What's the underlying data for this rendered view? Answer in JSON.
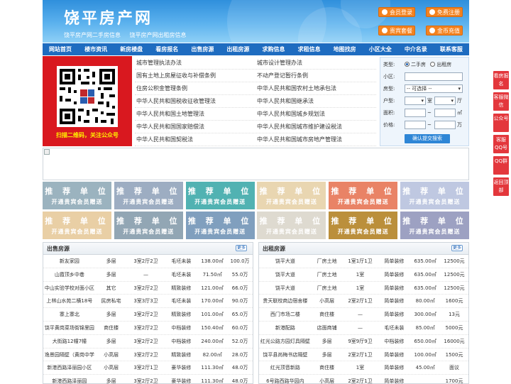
{
  "header": {
    "title": "饶平房产网",
    "subtitles": [
      "饶平房产网二手房信息",
      "饶平房产网出租房信息"
    ],
    "buttons": [
      "会员登录",
      "免费注册",
      "贵宾套餐",
      "金币充值"
    ]
  },
  "nav": [
    "网站首页",
    "楼市资讯",
    "新房楼盘",
    "看房报名",
    "出售房源",
    "出租房源",
    "求购信息",
    "求租信息",
    "地图找房",
    "小区大全",
    "中介名录",
    "联系客服"
  ],
  "qr": {
    "caption": "扫描二维码，关注公众号"
  },
  "links": [
    [
      "城市管理执法办法",
      "城市设计管理办法"
    ],
    [
      "国有土地上房屋征收与补偿条例",
      "不动产登记暂行条例"
    ],
    [
      "住房公积金管理条例",
      "中华人民共和国农村土地承包法"
    ],
    [
      "中华人民共和国税收征收管理法",
      "中华人民共和国继承法"
    ],
    [
      "中华人民共和国土地管理法",
      "中华人民共和国城乡规划法"
    ],
    [
      "中华人民共和国国家赔偿法",
      "中华人民共和国城市维护建设税法"
    ],
    [
      "中华人民共和国契税法",
      "中华人民共和国城市房地产管理法"
    ]
  ],
  "search": {
    "type_label": "类型:",
    "type_options": [
      "二手房",
      "出租房"
    ],
    "community_label": "小区:",
    "house_type_label": "房型:",
    "house_type_value": "-- 可选择 --",
    "layout_label": "户型:",
    "room_label": "室",
    "hall_label": "厅",
    "area_label": "面积:",
    "area_unit": "㎡",
    "range_sep": "~",
    "price_label": "价格:",
    "price_unit": "万",
    "submit": "确认提交搜索"
  },
  "tiles": {
    "title": "推 荐 单 位",
    "subtitle": "开通贵宾会员赠送",
    "colors": [
      "#8aa6b4",
      "#8c9fb8",
      "#33a5a5",
      "#e6cfa4",
      "#e66e4c",
      "#b4bfdc",
      "#e6c796",
      "#7f97a8",
      "#6b8fb3",
      "#d9d4c8",
      "#b07c1a",
      "#8c91b8"
    ]
  },
  "sale": {
    "title": "出售房源",
    "more": "更多",
    "rows": [
      [
        "新友家园",
        "多层",
        "3室2厅2卫",
        "毛坯未装",
        "138.00㎡",
        "100.0万"
      ],
      [
        "山霞顶乡中巷",
        "多层",
        "—",
        "毛坯未装",
        "71.50㎡",
        "55.0万"
      ],
      [
        "中山实验学校对面小区",
        "其它",
        "3室2厅2卫",
        "精致装修",
        "121.00㎡",
        "66.0万"
      ],
      [
        "上林山水苑二横18号",
        "民房私宅",
        "3室3厅3卫",
        "毛坯未装",
        "170.00㎡",
        "90.0万"
      ],
      [
        "寨上寨北",
        "多层",
        "3室2厅2卫",
        "精致装修",
        "101.00㎡",
        "65.0万"
      ],
      [
        "饶平黄岗菜场街锦里园",
        "商住楼",
        "3室2厅2卫",
        "中档装修",
        "150.40㎡",
        "60.0万"
      ],
      [
        "大街路12幢7幢",
        "多层",
        "3室2厅2卫",
        "中档装修",
        "240.00㎡",
        "52.0万"
      ],
      [
        "逸景园隔壁（黄岗中学",
        "小高层",
        "3室2厅2卫",
        "精致装修",
        "82.00㎡",
        "28.0万"
      ],
      [
        "新港西路泽丽园小区",
        "小高层",
        "3室2厅1卫",
        "豪华装修",
        "111.30㎡",
        "48.0万"
      ],
      [
        "新港西路泽丽园",
        "多层",
        "3室2厅2卫",
        "豪华装修",
        "111.30㎡",
        "48.0万"
      ]
    ]
  },
  "rent": {
    "title": "出租房源",
    "more": "更多",
    "rows": [
      [
        "饶平大道",
        "厂房土地",
        "1室1厅1卫",
        "简单装修",
        "635.00㎡",
        "12500元"
      ],
      [
        "饶平大道",
        "厂房土地",
        "1室",
        "简单装修",
        "635.00㎡",
        "12500元"
      ],
      [
        "饶平大道",
        "厂房土地",
        "1室",
        "简单装修",
        "635.00㎡",
        "12500元"
      ],
      [
        "贵天联校商边宿舍楼",
        "小高层",
        "2室2厅1卫",
        "简单装修",
        "80.00㎡",
        "1600元"
      ],
      [
        "西门市场二楼",
        "商住楼",
        "—",
        "简单装修",
        "300.00㎡",
        "13元"
      ],
      [
        "新港配路",
        "店面商铺",
        "—",
        "毛坯未装",
        "85.00㎡",
        "5000元"
      ],
      [
        "红光公路方园灯具隔壁",
        "多层",
        "9室9厅9卫",
        "中档装修",
        "650.00㎡",
        "16000元"
      ],
      [
        "饶平县尚梅书店隔壁",
        "多层",
        "2室2厅1卫",
        "简单装修",
        "100.00㎡",
        "1500元"
      ],
      [
        "红光顶音新路",
        "商住楼",
        "1室",
        "简单装修",
        "45.00㎡",
        "面议"
      ],
      [
        "6号路西路华园内",
        "小高层",
        "2室2厅1卫",
        "简单装修",
        "",
        "1700元"
      ]
    ]
  },
  "float": [
    "看房报名",
    "客服微信",
    "公众号",
    "客服QQ号",
    "QQ群",
    "返回顶部"
  ]
}
